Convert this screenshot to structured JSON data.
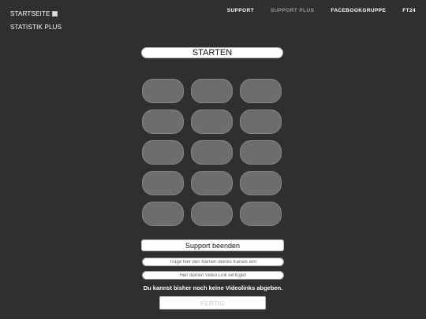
{
  "nav": {
    "home": "STARTSEITE",
    "stats": "STATISTIK PLUS",
    "links": [
      "SUPPORT",
      "SUPPORT PLUS",
      "FACEBOOKGRUPPE",
      "FT24"
    ]
  },
  "main": {
    "start_label": "STARTEN",
    "grid_rows": 5,
    "grid_cols": 3,
    "end_label": "Support beenden",
    "channel_placeholder": "Trage hier den Namen deines Kanals ein!",
    "video_placeholder": "Hier deinen Video Link einfügen",
    "status_text": "Du kannst bisher noch keine Videolinks abgeben.",
    "done_label": "FERTIG"
  },
  "colors": {
    "background": "#2f2f2f",
    "cell": "#6d6d6d",
    "nav_muted": "#9a9a9a"
  }
}
